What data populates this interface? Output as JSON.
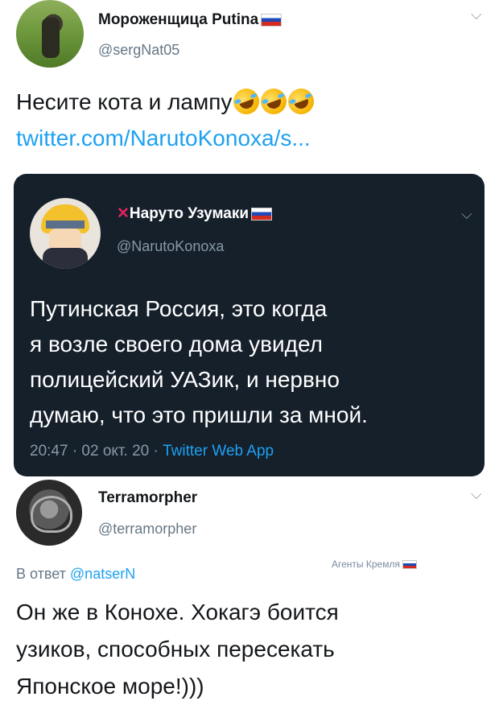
{
  "tweet1": {
    "author_name": "Мороженщица Putina",
    "handle": "@sergNat05",
    "text": "Несите кота и лампу",
    "link": "twitter.com/NarutoKonoxa/s..."
  },
  "quoted": {
    "cross": "✕",
    "author_name": "Наруто Узумаки",
    "handle": "@NarutoKonoxa",
    "text_lines": [
      "Путинская Россия, это когда",
      "я возле своего дома увидел",
      "полицейский УАЗик, и нервно",
      "думаю, что это пришли за мной."
    ],
    "time_date": "20:47 · 02 окт. 20 ·",
    "source": "Twitter Web App"
  },
  "tweet2": {
    "author_name": "Terramorpher",
    "handle": "@terramorpher",
    "reply_prefix": "В ответ",
    "reply_handle": "@natserN",
    "watermark": "Агенты Кремля",
    "text_lines": [
      "Он же в Конохе. Хокагэ боится",
      "узиков, способных пересекать",
      "Японское море!)))"
    ]
  },
  "colors": {
    "link": "#1da1f2",
    "dark_bg": "#15202b",
    "muted": "#657786",
    "cross": "#e0245e"
  }
}
